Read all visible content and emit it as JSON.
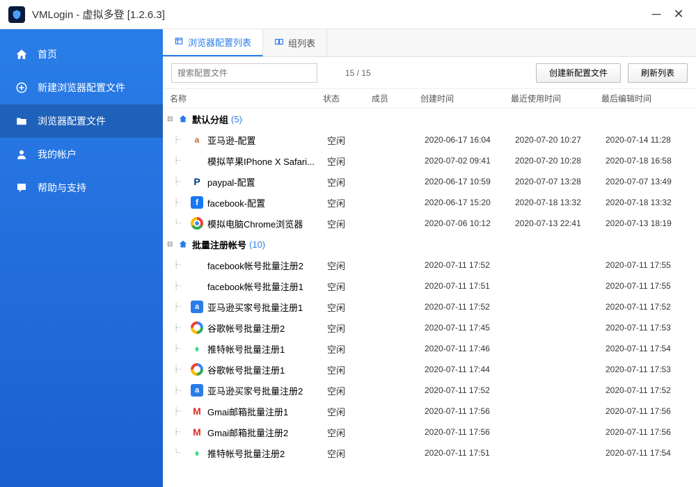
{
  "window": {
    "title": "VMLogin - 虚拟多登 [1.2.6.3]"
  },
  "sidebar": {
    "items": [
      {
        "label": "首页",
        "icon": "home-icon"
      },
      {
        "label": "新建浏览器配置文件",
        "icon": "plus-icon"
      },
      {
        "label": "浏览器配置文件",
        "icon": "folder-icon"
      },
      {
        "label": "我的帐户",
        "icon": "account-icon"
      },
      {
        "label": "帮助与支持",
        "icon": "help-icon"
      }
    ],
    "active": 2
  },
  "tabs": {
    "items": [
      {
        "label": "浏览器配置列表"
      },
      {
        "label": "组列表"
      }
    ],
    "active": 0
  },
  "toolbar": {
    "search_placeholder": "搜索配置文件",
    "count_text": "15 / 15",
    "create_label": "创建新配置文件",
    "refresh_label": "刷新列表"
  },
  "columns": {
    "name": "名称",
    "status": "状态",
    "member": "成员",
    "created": "创建时间",
    "lastuse": "最近使用时间",
    "lastedit": "最后编辑时间"
  },
  "groups": [
    {
      "name": "默认分组",
      "count": "(5)",
      "items": [
        {
          "icon": "amazon",
          "name": "亚马逊-配置",
          "status": "空闲",
          "member": "",
          "created": "2020-06-17 16:04",
          "lastuse": "2020-07-20 10:27",
          "lastedit": "2020-07-14 11:28"
        },
        {
          "icon": "apple",
          "name": "模拟苹果IPhone X Safari...",
          "status": "空闲",
          "member": "",
          "created": "2020-07-02 09:41",
          "lastuse": "2020-07-20 10:28",
          "lastedit": "2020-07-18 16:58"
        },
        {
          "icon": "paypal",
          "name": "paypal-配置",
          "status": "空闲",
          "member": "",
          "created": "2020-06-17 10:59",
          "lastuse": "2020-07-07 13:28",
          "lastedit": "2020-07-07 13:49"
        },
        {
          "icon": "fb",
          "name": "facebook-配置",
          "status": "空闲",
          "member": "",
          "created": "2020-06-17 15:20",
          "lastuse": "2020-07-18 13:32",
          "lastedit": "2020-07-18 13:32"
        },
        {
          "icon": "chrome",
          "name": "模拟电脑Chrome浏览器",
          "status": "空闲",
          "member": "",
          "created": "2020-07-06 10:12",
          "lastuse": "2020-07-13 22:41",
          "lastedit": "2020-07-13 18:19"
        }
      ]
    },
    {
      "name": "批量注册帐号",
      "count": "(10)",
      "items": [
        {
          "icon": "apple",
          "name": "facebook帐号批量注册2",
          "status": "空闲",
          "member": "",
          "created": "2020-07-11 17:52",
          "lastuse": "",
          "lastedit": "2020-07-11 17:55"
        },
        {
          "icon": "apple",
          "name": "facebook帐号批量注册1",
          "status": "空闲",
          "member": "",
          "created": "2020-07-11 17:51",
          "lastuse": "",
          "lastedit": "2020-07-11 17:55"
        },
        {
          "icon": "az",
          "name": "亚马逊买家号批量注册1",
          "status": "空闲",
          "member": "",
          "created": "2020-07-11 17:52",
          "lastuse": "",
          "lastedit": "2020-07-11 17:52"
        },
        {
          "icon": "google",
          "name": "谷歌帐号批量注册2",
          "status": "空闲",
          "member": "",
          "created": "2020-07-11 17:45",
          "lastuse": "",
          "lastedit": "2020-07-11 17:53"
        },
        {
          "icon": "android",
          "name": "推特帐号批量注册1",
          "status": "空闲",
          "member": "",
          "created": "2020-07-11 17:46",
          "lastuse": "",
          "lastedit": "2020-07-11 17:54"
        },
        {
          "icon": "google",
          "name": "谷歌帐号批量注册1",
          "status": "空闲",
          "member": "",
          "created": "2020-07-11 17:44",
          "lastuse": "",
          "lastedit": "2020-07-11 17:53"
        },
        {
          "icon": "az",
          "name": "亚马逊买家号批量注册2",
          "status": "空闲",
          "member": "",
          "created": "2020-07-11 17:52",
          "lastuse": "",
          "lastedit": "2020-07-11 17:52"
        },
        {
          "icon": "gmail",
          "name": "Gmai邮箱批量注册1",
          "status": "空闲",
          "member": "",
          "created": "2020-07-11 17:56",
          "lastuse": "",
          "lastedit": "2020-07-11 17:56"
        },
        {
          "icon": "gmail",
          "name": "Gmai邮箱批量注册2",
          "status": "空闲",
          "member": "",
          "created": "2020-07-11 17:56",
          "lastuse": "",
          "lastedit": "2020-07-11 17:56"
        },
        {
          "icon": "android",
          "name": "推特帐号批量注册2",
          "status": "空闲",
          "member": "",
          "created": "2020-07-11 17:51",
          "lastuse": "",
          "lastedit": "2020-07-11 17:54"
        }
      ]
    }
  ]
}
